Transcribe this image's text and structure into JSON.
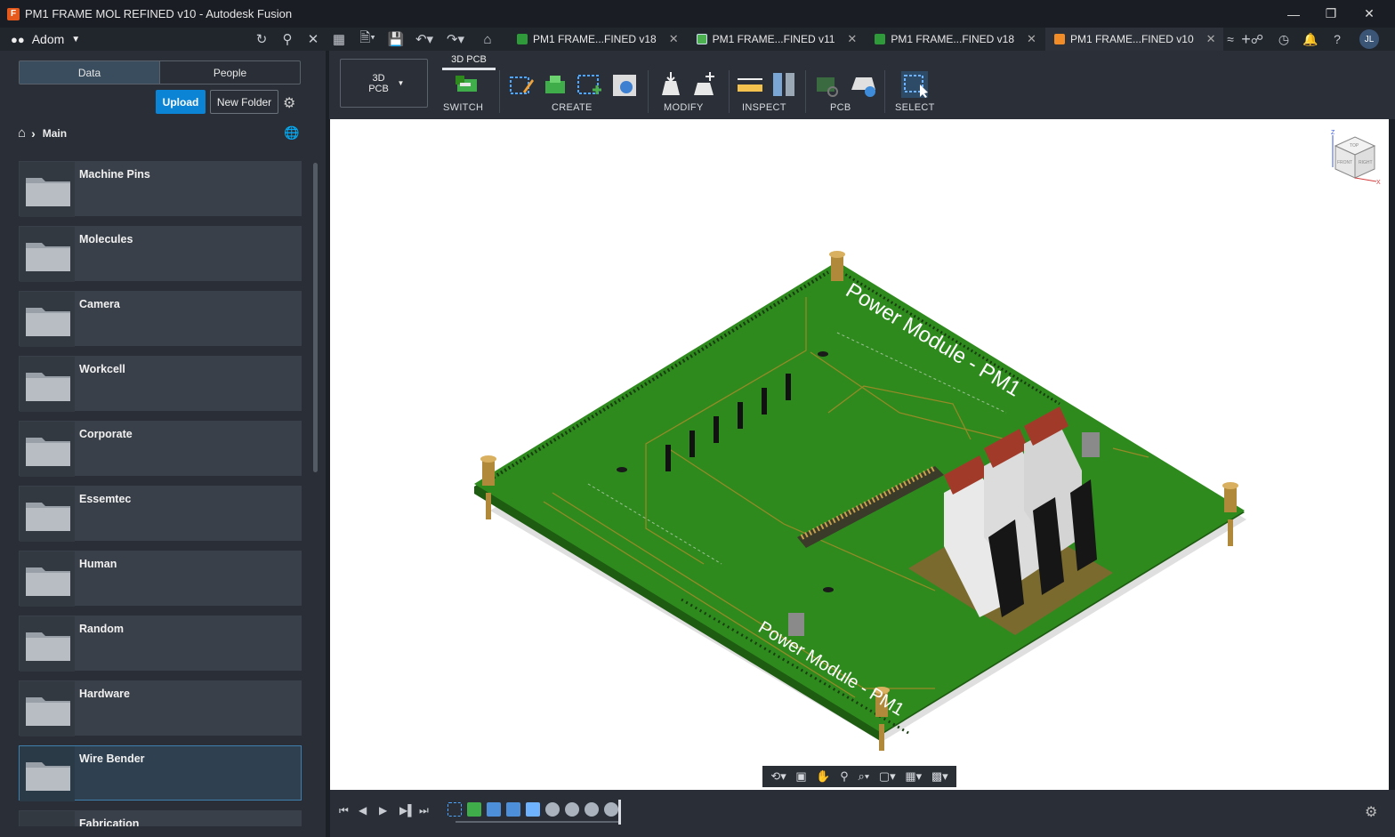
{
  "window": {
    "title": "PM1 FRAME MOL REFINED v10 - Autodesk Fusion",
    "controls": [
      "minimize",
      "restore",
      "close"
    ]
  },
  "header": {
    "team_name": "Adom",
    "tabs": [
      {
        "label": "PM1 FRAME...FINED v18",
        "icon": "pcb-icon",
        "active": false
      },
      {
        "label": "PM1 FRAME...FINED v11",
        "icon": "schematic-icon",
        "active": false
      },
      {
        "label": "PM1 FRAME...FINED v18",
        "icon": "pcb-icon",
        "active": false
      },
      {
        "label": "PM1 FRAME...FINED v10",
        "icon": "design-icon",
        "active": true
      }
    ],
    "user_initials": "JL"
  },
  "data_panel": {
    "tabs": [
      "Data",
      "People"
    ],
    "upload_label": "Upload",
    "new_folder_label": "New Folder",
    "breadcrumb": "Main",
    "folders": [
      {
        "name": "Machine Pins"
      },
      {
        "name": "Molecules"
      },
      {
        "name": "Camera"
      },
      {
        "name": "Workcell"
      },
      {
        "name": "Corporate"
      },
      {
        "name": "Essemtec"
      },
      {
        "name": "Human"
      },
      {
        "name": "Random"
      },
      {
        "name": "Hardware"
      },
      {
        "name": "Wire Bender",
        "selected": true
      },
      {
        "name": "Fabrication"
      }
    ]
  },
  "toolbar": {
    "workspace": "3D PCB",
    "workspace_tab": "3D PCB",
    "groups": [
      "SWITCH",
      "CREATE",
      "MODIFY",
      "INSPECT",
      "PCB",
      "SELECT"
    ]
  },
  "viewport": {
    "board_labels": [
      "Power Module - PM1",
      "Power Module - PM1"
    ],
    "viewcube": {
      "top": "TOP",
      "front": "FRONT",
      "right": "RIGHT"
    },
    "axes": [
      "Z",
      "X"
    ]
  },
  "colors": {
    "accent": "#0b84d6",
    "pcb_green": "#2f8a1e",
    "selected_border": "#3f7fae"
  }
}
